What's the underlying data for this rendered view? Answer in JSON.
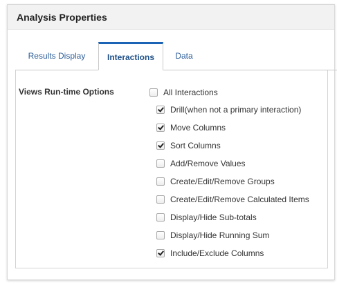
{
  "dialog": {
    "title": "Analysis Properties"
  },
  "tabs": [
    {
      "label": "Results Display",
      "active": false
    },
    {
      "label": "Interactions",
      "active": true
    },
    {
      "label": "Data",
      "active": false
    }
  ],
  "views_runtime": {
    "label": "Views Run-time Options",
    "options": [
      {
        "label": "All Interactions",
        "checked": false
      },
      {
        "label": "Drill(when not a primary interaction)",
        "checked": true
      },
      {
        "label": "Move Columns",
        "checked": true
      },
      {
        "label": "Sort Columns",
        "checked": true
      },
      {
        "label": "Add/Remove Values",
        "checked": false
      },
      {
        "label": "Create/Edit/Remove Groups",
        "checked": false
      },
      {
        "label": "Create/Edit/Remove Calculated Items",
        "checked": false
      },
      {
        "label": "Display/Hide Sub-totals",
        "checked": false
      },
      {
        "label": "Display/Hide Running Sum",
        "checked": false
      },
      {
        "label": "Include/Exclude Columns",
        "checked": true
      }
    ]
  },
  "colors": {
    "tab_active_accent": "#1a63b5",
    "tab_text": "#2f5f9a",
    "header_bg": "#f2f2f2"
  }
}
